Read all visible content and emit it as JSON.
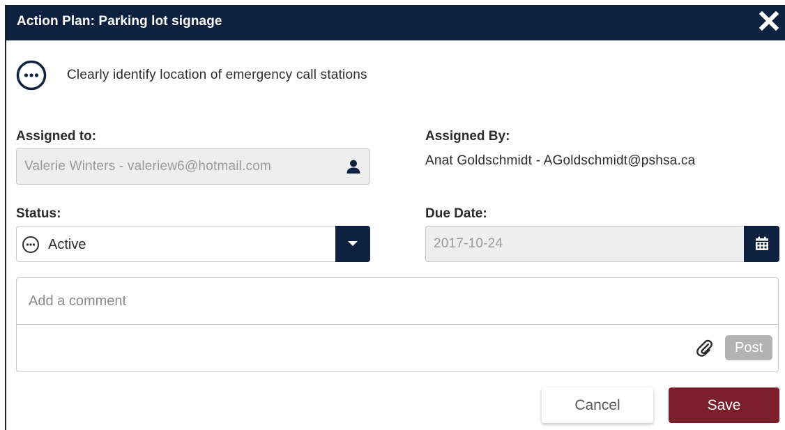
{
  "dialog": {
    "title": "Action Plan: Parking lot signage"
  },
  "action_item": {
    "description": "Clearly identify location of emergency call stations",
    "icon": "more-circle-icon"
  },
  "assigned_to": {
    "label": "Assigned to:",
    "value": "Valerie Winters - valeriew6@hotmail.com",
    "icon": "person-icon"
  },
  "assigned_by": {
    "label": "Assigned By:",
    "value": "Anat Goldschmidt - AGoldschmidt@pshsa.ca"
  },
  "status": {
    "label": "Status:",
    "value": "Active",
    "icon": "more-circle-icon"
  },
  "due_date": {
    "label": "Due Date:",
    "value": "2017-10-24",
    "icon": "calendar-icon"
  },
  "comment": {
    "placeholder": "Add a comment",
    "post_label": "Post",
    "attach_icon": "paperclip-icon"
  },
  "actions": {
    "cancel_label": "Cancel",
    "save_label": "Save"
  },
  "colors": {
    "header_bg": "#0e2240",
    "save_bg": "#7a1f2b",
    "disabled_bg": "#eeeeee",
    "post_bg": "#b3b3b3"
  }
}
